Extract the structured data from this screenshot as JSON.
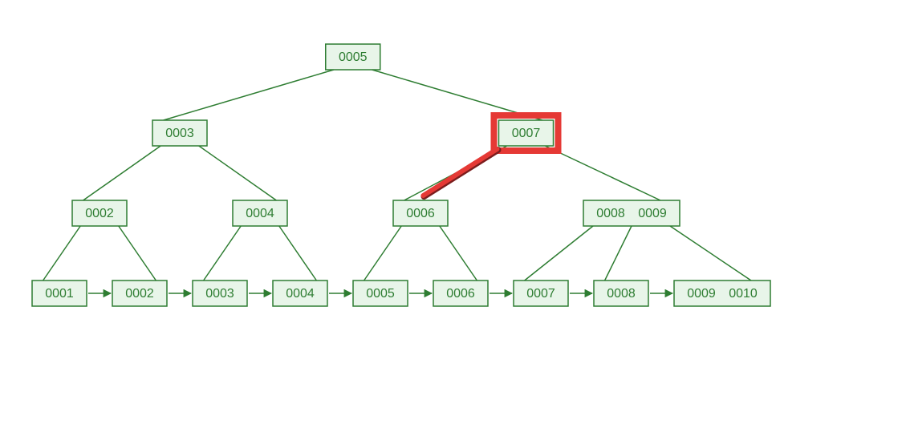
{
  "diagram": {
    "type": "b-tree",
    "highlight": {
      "internal_index": 2,
      "edge_label": "0006-0007",
      "color": "#e53935"
    },
    "colors": {
      "stroke": "#2e7d32",
      "fill": "#e8f5e9",
      "highlight": "#e53935"
    },
    "root": {
      "id": "root",
      "keys": [
        "0005"
      ]
    },
    "internal": [
      {
        "id": "i1",
        "keys": [
          "0003"
        ]
      },
      {
        "id": "i2",
        "keys": [
          "0007"
        ]
      }
    ],
    "branch": [
      {
        "id": "b1",
        "keys": [
          "0002"
        ]
      },
      {
        "id": "b2",
        "keys": [
          "0004"
        ]
      },
      {
        "id": "b3",
        "keys": [
          "0006"
        ]
      },
      {
        "id": "b4",
        "keys": [
          "0008",
          "0009"
        ]
      }
    ],
    "leaves": [
      {
        "id": "l1",
        "keys": [
          "0001"
        ]
      },
      {
        "id": "l2",
        "keys": [
          "0002"
        ]
      },
      {
        "id": "l3",
        "keys": [
          "0003"
        ]
      },
      {
        "id": "l4",
        "keys": [
          "0004"
        ]
      },
      {
        "id": "l5",
        "keys": [
          "0005"
        ]
      },
      {
        "id": "l6",
        "keys": [
          "0006"
        ]
      },
      {
        "id": "l7",
        "keys": [
          "0007"
        ]
      },
      {
        "id": "l8",
        "keys": [
          "0008"
        ]
      },
      {
        "id": "l9",
        "keys": [
          "0009",
          "0010"
        ]
      }
    ],
    "tree_edges": [
      [
        "root",
        "i1"
      ],
      [
        "root",
        "i2"
      ],
      [
        "i1",
        "b1"
      ],
      [
        "i1",
        "b2"
      ],
      [
        "i2",
        "b3"
      ],
      [
        "i2",
        "b4"
      ],
      [
        "b1",
        "l1"
      ],
      [
        "b1",
        "l2"
      ],
      [
        "b2",
        "l3"
      ],
      [
        "b2",
        "l4"
      ],
      [
        "b3",
        "l5"
      ],
      [
        "b3",
        "l6"
      ],
      [
        "b4",
        "l7"
      ],
      [
        "b4",
        "l8"
      ],
      [
        "b4",
        "l9"
      ]
    ],
    "leaf_links": [
      [
        "l1",
        "l2"
      ],
      [
        "l2",
        "l3"
      ],
      [
        "l3",
        "l4"
      ],
      [
        "l4",
        "l5"
      ],
      [
        "l5",
        "l6"
      ],
      [
        "l6",
        "l7"
      ],
      [
        "l7",
        "l8"
      ],
      [
        "l8",
        "l9"
      ]
    ]
  }
}
